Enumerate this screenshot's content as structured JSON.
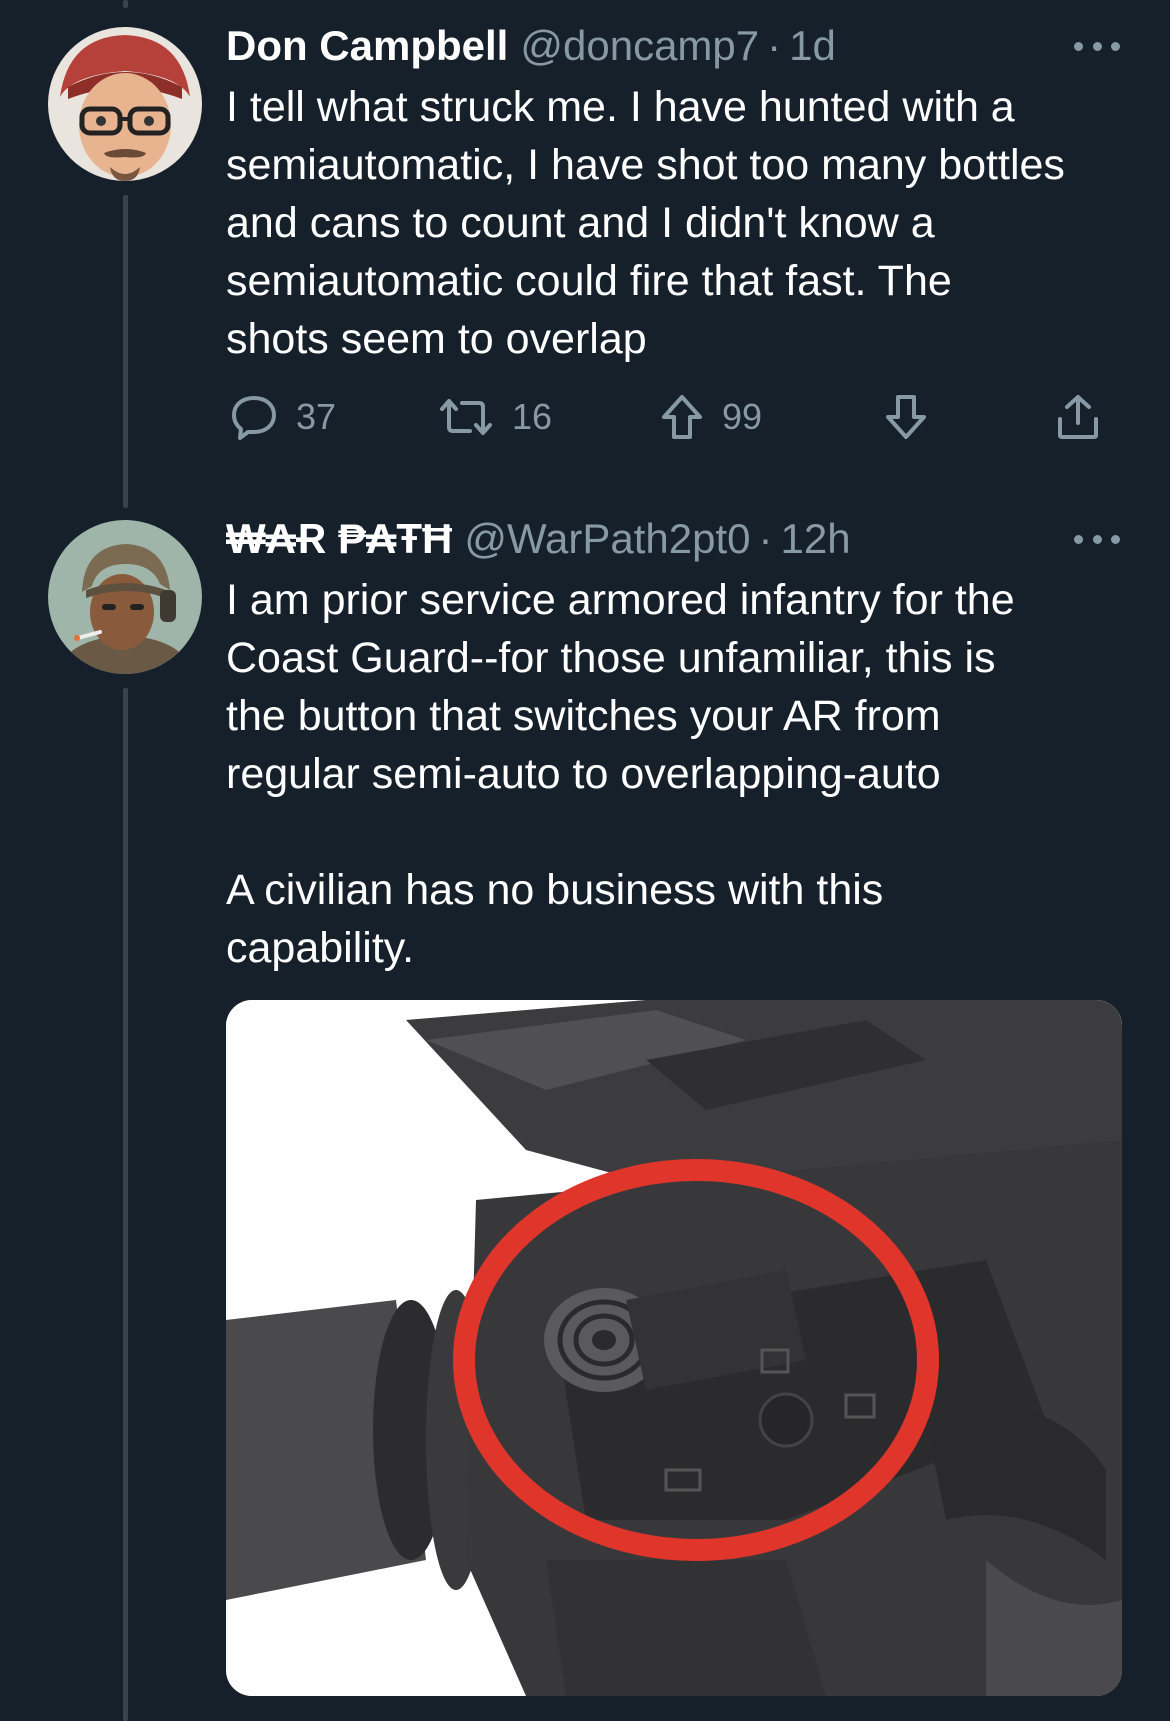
{
  "tweets": [
    {
      "name": "Don Campbell",
      "handle": "@doncamp7",
      "separator": "·",
      "time": "1d",
      "text": "I tell what struck me. I have hunted with a\nsemiautomatic, I have shot too many bottles\nand cans to count and I didn't know a\nsemiautomatic could fire that fast. The\nshots seem to overlap",
      "actions": {
        "reply_count": "37",
        "retweet_count": "16",
        "upvote_count": "99"
      }
    },
    {
      "name": "₩₳Ɍ ₱₳ŦĦ",
      "handle": "@WarPath2pt0",
      "separator": "·",
      "time": "12h",
      "text": "I am prior service armored infantry for the\nCoast Guard--for those unfamiliar, this is\nthe button that switches your AR from\nregular semi-auto to overlapping-auto\n\nA civilian has no business with this\ncapability."
    }
  ],
  "colors": {
    "background": "#15202b",
    "secondary_text": "#8899a6",
    "thread_line": "#38444d",
    "highlight_circle": "#e0352b"
  },
  "icons": [
    "reply-icon",
    "retweet-icon",
    "upvote-icon",
    "downvote-icon",
    "share-icon",
    "more-icon"
  ]
}
